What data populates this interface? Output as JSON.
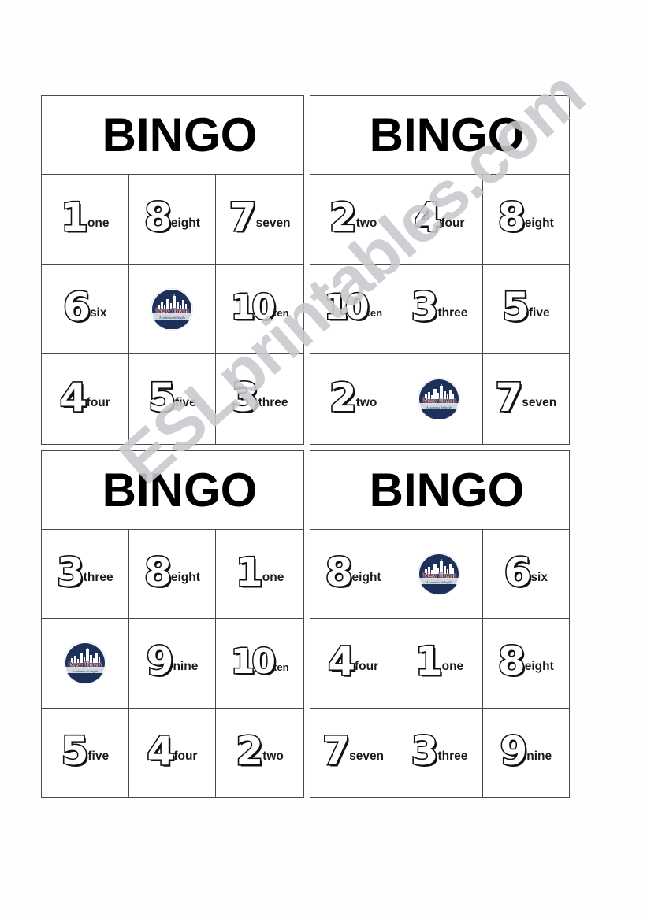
{
  "page": {
    "background_color": "#fefeff",
    "border_color": "#4a4a50"
  },
  "watermark": {
    "text": "ESLprintables.com",
    "color": "#c9c9cd",
    "rotation_deg": -41
  },
  "free_space_logo": {
    "name": "New Town",
    "subtitle": "Academia de Inglés",
    "disc_color": "#1d3059",
    "name_color": "#7a2230"
  },
  "cards": [
    {
      "title": "BINGO",
      "cells": [
        {
          "type": "number",
          "number": "1",
          "word": "one"
        },
        {
          "type": "number",
          "number": "8",
          "word": "eight"
        },
        {
          "type": "number",
          "number": "7",
          "word": "seven"
        },
        {
          "type": "number",
          "number": "6",
          "word": "six"
        },
        {
          "type": "logo",
          "number": "",
          "word": ""
        },
        {
          "type": "number",
          "number": "10",
          "word": "ten"
        },
        {
          "type": "number",
          "number": "4",
          "word": "four"
        },
        {
          "type": "number",
          "number": "5",
          "word": "five"
        },
        {
          "type": "number",
          "number": "3",
          "word": "three"
        }
      ]
    },
    {
      "title": "BINGO",
      "cells": [
        {
          "type": "number",
          "number": "2",
          "word": "two"
        },
        {
          "type": "number",
          "number": "4",
          "word": "four"
        },
        {
          "type": "number",
          "number": "8",
          "word": "eight"
        },
        {
          "type": "number",
          "number": "10",
          "word": "ten"
        },
        {
          "type": "number",
          "number": "3",
          "word": "three"
        },
        {
          "type": "number",
          "number": "5",
          "word": "five"
        },
        {
          "type": "number",
          "number": "2",
          "word": "two"
        },
        {
          "type": "logo",
          "number": "",
          "word": ""
        },
        {
          "type": "number",
          "number": "7",
          "word": "seven"
        }
      ]
    },
    {
      "title": "BINGO",
      "cells": [
        {
          "type": "number",
          "number": "3",
          "word": "three"
        },
        {
          "type": "number",
          "number": "8",
          "word": "eight"
        },
        {
          "type": "number",
          "number": "1",
          "word": "one"
        },
        {
          "type": "logo",
          "number": "",
          "word": ""
        },
        {
          "type": "number",
          "number": "9",
          "word": "nine"
        },
        {
          "type": "number",
          "number": "10",
          "word": "ten"
        },
        {
          "type": "number",
          "number": "5",
          "word": "five"
        },
        {
          "type": "number",
          "number": "4",
          "word": "four"
        },
        {
          "type": "number",
          "number": "2",
          "word": "two"
        }
      ]
    },
    {
      "title": "BINGO",
      "cells": [
        {
          "type": "number",
          "number": "8",
          "word": "eight"
        },
        {
          "type": "logo",
          "number": "",
          "word": ""
        },
        {
          "type": "number",
          "number": "6",
          "word": "six"
        },
        {
          "type": "number",
          "number": "4",
          "word": "four"
        },
        {
          "type": "number",
          "number": "1",
          "word": "one"
        },
        {
          "type": "number",
          "number": "8",
          "word": "eight"
        },
        {
          "type": "number",
          "number": "7",
          "word": "seven"
        },
        {
          "type": "number",
          "number": "3",
          "word": "three"
        },
        {
          "type": "number",
          "number": "9",
          "word": "nine"
        }
      ]
    }
  ]
}
